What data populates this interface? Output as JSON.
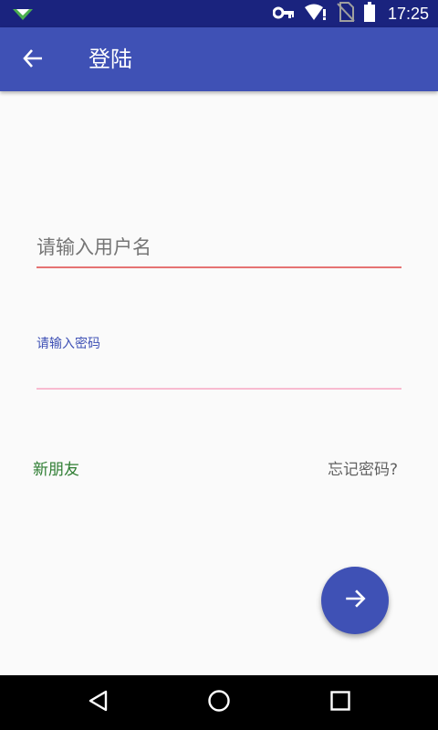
{
  "status_bar": {
    "time": "17:25",
    "icons": [
      "notification-app-icon",
      "vpn-key-icon",
      "wifi-alert-icon",
      "no-sim-icon",
      "battery-icon"
    ]
  },
  "toolbar": {
    "title": "登陆",
    "back_icon": "arrow-back-icon"
  },
  "form": {
    "username_placeholder": "请输入用户名",
    "password_label": "请输入密码",
    "password_value": ""
  },
  "links": {
    "new_friend": "新朋友",
    "forgot_password": "忘记密码?"
  },
  "fab": {
    "icon": "arrow-forward-icon"
  },
  "nav_bar": {
    "icons": [
      "back-triangle-icon",
      "home-circle-icon",
      "recents-square-icon"
    ]
  },
  "colors": {
    "status_bar": "#1a237e",
    "primary": "#3f51b5",
    "error_underline": "#e57373",
    "accent_underline": "#f8bbd0",
    "new_friend_text": "#2e7d32",
    "forgot_text": "#616161"
  }
}
